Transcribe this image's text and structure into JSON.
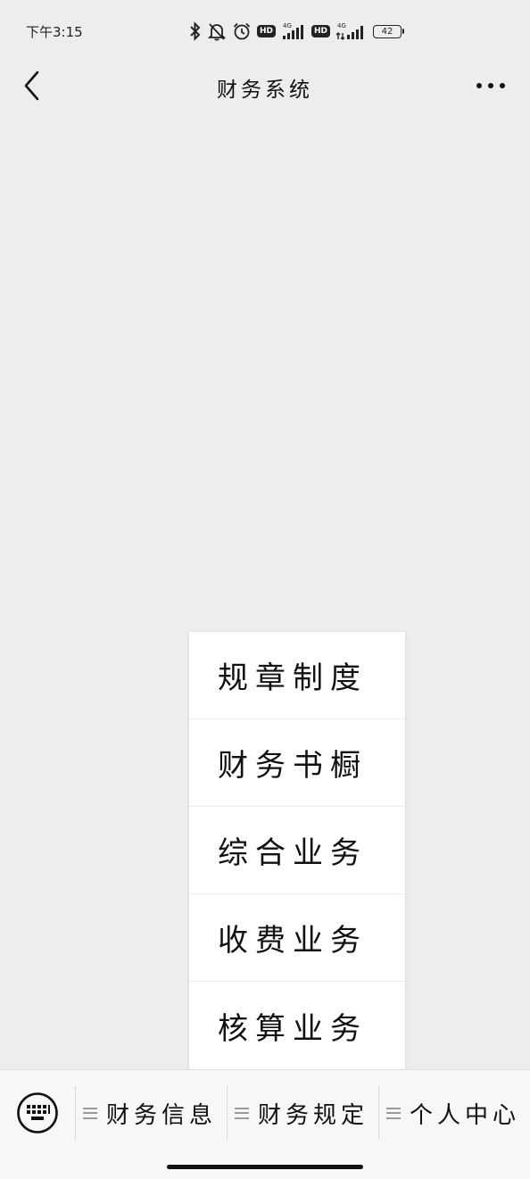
{
  "status_bar": {
    "time": "下午3:15",
    "network_1": "4G",
    "network_2": "4G",
    "hd_badge": "HD",
    "battery": "42"
  },
  "nav": {
    "title": "财务系统"
  },
  "popup_menu": {
    "items": [
      {
        "label": "规章制度"
      },
      {
        "label": "财务书橱"
      },
      {
        "label": "综合业务"
      },
      {
        "label": "收费业务"
      },
      {
        "label": "核算业务"
      }
    ]
  },
  "bottom_bar": {
    "tabs": [
      {
        "label": "财务信息"
      },
      {
        "label": "财务规定"
      },
      {
        "label": "个人中心"
      }
    ]
  },
  "colors": {
    "background": "#ededed",
    "menu_background": "#ffffff",
    "bottom_bar_background": "#f7f7f7"
  }
}
